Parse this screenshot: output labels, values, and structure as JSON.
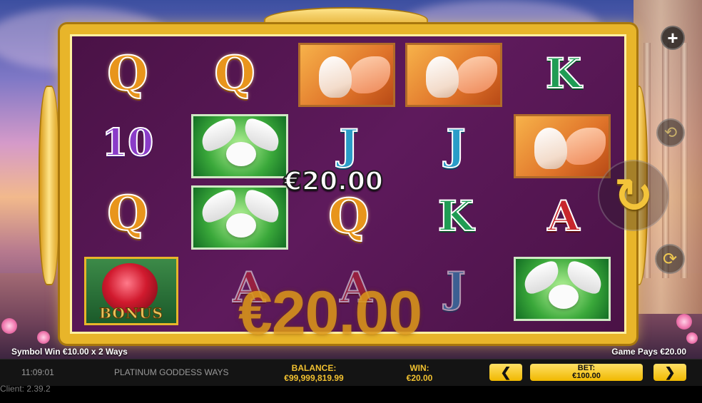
{
  "game": {
    "title": "PLATINUM GODDESS WAYS",
    "time": "11:09:01",
    "client_version": "Client: 2.39.2"
  },
  "reels": {
    "grid": [
      [
        "Q",
        "10",
        "Q",
        "BONUS rose"
      ],
      [
        "Q",
        "dove",
        "dove",
        "A"
      ],
      [
        "pegasus",
        "J",
        "Q",
        "A"
      ],
      [
        "pegasus",
        "J",
        "K",
        "J"
      ],
      [
        "K",
        "pegasus",
        "A",
        "dove"
      ]
    ],
    "bonus_label": "BONUS"
  },
  "win": {
    "overlay_small": "€20.00",
    "overlay_big": "€20.00",
    "symbol_win": "Symbol Win €10.00 x 2 Ways",
    "game_pays": "Game Pays €20.00"
  },
  "bottom_bar": {
    "balance_label": "BALANCE:",
    "balance_value": "€99,999,819.99",
    "win_label": "WIN:",
    "win_value": "€20.00",
    "bet_label": "BET:",
    "bet_value": "€100.00",
    "prev_glyph": "❮",
    "next_glyph": "❯"
  },
  "controls": {
    "plus_glyph": "+",
    "autoplay_glyph": "⟲",
    "spin_glyph": "↻",
    "turbo_glyph": "⟳"
  },
  "colors": {
    "frame_gold": "#e8b52a",
    "reel_background": "#5e1a5c",
    "accent_yellow": "#f0c030"
  }
}
